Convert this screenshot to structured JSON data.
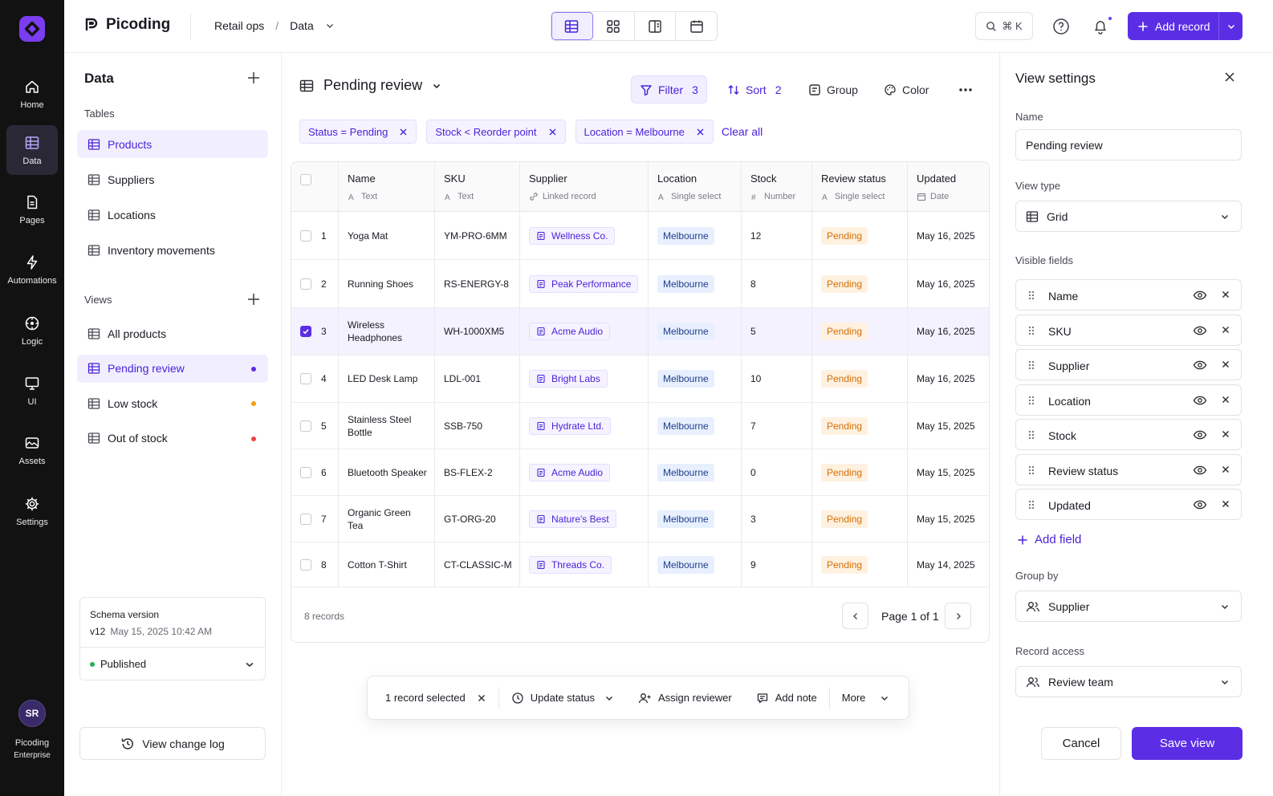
{
  "app": {
    "name": "Picoding",
    "plan_line1": "Picoding",
    "plan_line2": "Enterprise",
    "avatar": "SR",
    "accent": "#5b2ee6"
  },
  "rail": [
    {
      "label": "Home",
      "icon": "home-icon"
    },
    {
      "label": "Data",
      "icon": "table-icon",
      "active": true
    },
    {
      "label": "Pages",
      "icon": "page-icon"
    },
    {
      "label": "Automations",
      "icon": "bolt-icon"
    },
    {
      "label": "Logic",
      "icon": "logic-icon"
    },
    {
      "label": "UI",
      "icon": "monitor-icon"
    },
    {
      "label": "Assets",
      "icon": "image-icon"
    },
    {
      "label": "Settings",
      "icon": "gear-icon"
    }
  ],
  "topbar": {
    "breadcrumb": [
      "Retail ops",
      "/",
      "Data"
    ],
    "view_modes": [
      "grid-view-icon",
      "gallery-view-icon",
      "split-view-icon",
      "calendar-view-icon"
    ],
    "cmdk": "⌘ K",
    "add_record": "Add record"
  },
  "left": {
    "title": "Data",
    "tables_label": "Tables",
    "tables": [
      "Products",
      "Suppliers",
      "Locations",
      "Inventory movements"
    ],
    "views_label": "Views",
    "views": [
      {
        "label": "All products"
      },
      {
        "label": "Pending review",
        "dot": "#5b2ee6"
      },
      {
        "label": "Low stock",
        "dot": "#f59e0b"
      },
      {
        "label": "Out of stock",
        "dot": "#ef4444"
      }
    ],
    "schema": {
      "title": "Schema version",
      "version": "v12",
      "date": "May 15, 2025  10:42 AM",
      "status": "Published"
    },
    "change_log": "View change log"
  },
  "main": {
    "view_title": "Pending review",
    "filter": {
      "label": "Filter",
      "count": "3"
    },
    "sort": {
      "label": "Sort",
      "count": "2"
    },
    "group": "Group",
    "color": "Color",
    "chips": [
      "Status = Pending",
      "Stock < Reorder point",
      "Location = Melbourne"
    ],
    "clear_all": "Clear all",
    "columns": [
      {
        "name": "Name",
        "type": "Text"
      },
      {
        "name": "SKU",
        "type": "Text"
      },
      {
        "name": "Supplier",
        "type": "Linked record"
      },
      {
        "name": "Location",
        "type": "Single select"
      },
      {
        "name": "Stock",
        "type": "Number"
      },
      {
        "name": "Review status",
        "type": "Single select"
      },
      {
        "name": "Updated",
        "type": "Date"
      }
    ],
    "rows": [
      {
        "n": "1",
        "name": "Yoga Mat",
        "sku": "YM-PRO-6MM",
        "supplier": "Wellness Co.",
        "location": "Melbourne",
        "stock": "12",
        "status": "Pending",
        "updated": "May 16, 2025"
      },
      {
        "n": "2",
        "name": "Running Shoes",
        "sku": "RS-ENERGY-8",
        "supplier": "Peak Performance",
        "location": "Melbourne",
        "stock": "8",
        "status": "Pending",
        "updated": "May 16, 2025"
      },
      {
        "n": "3",
        "name": "Wireless Headphones",
        "sku": "WH-1000XM5",
        "supplier": "Acme Audio",
        "location": "Melbourne",
        "stock": "5",
        "status": "Pending",
        "updated": "May 16, 2025",
        "selected": true
      },
      {
        "n": "4",
        "name": "LED Desk Lamp",
        "sku": "LDL-001",
        "supplier": "Bright Labs",
        "location": "Melbourne",
        "stock": "10",
        "status": "Pending",
        "updated": "May 16, 2025"
      },
      {
        "n": "5",
        "name": "Stainless Steel Bottle",
        "sku": "SSB-750",
        "supplier": "Hydrate Ltd.",
        "location": "Melbourne",
        "stock": "7",
        "status": "Pending",
        "updated": "May 15, 2025"
      },
      {
        "n": "6",
        "name": "Bluetooth Speaker",
        "sku": "BS-FLEX-2",
        "supplier": "Acme Audio",
        "location": "Melbourne",
        "stock": "0",
        "status": "Pending",
        "updated": "May 15, 2025"
      },
      {
        "n": "7",
        "name": "Organic Green Tea",
        "sku": "GT-ORG-20",
        "supplier": "Nature's Best",
        "location": "Melbourne",
        "stock": "3",
        "status": "Pending",
        "updated": "May 15, 2025"
      },
      {
        "n": "8",
        "name": "Cotton T-Shirt",
        "sku": "CT-CLASSIC-M",
        "supplier": "Threads Co.",
        "location": "Melbourne",
        "stock": "9",
        "status": "Pending",
        "updated": "May 14, 2025"
      }
    ],
    "record_count": "8 records",
    "page": "Page 1 of 1",
    "action_bar": {
      "selected": "1 record selected",
      "update_status": "Update status",
      "assign": "Assign reviewer",
      "note": "Add note",
      "more": "More"
    }
  },
  "settings": {
    "title": "View settings",
    "name_label": "Name",
    "name_value": "Pending review",
    "type_label": "View type",
    "type_value": "Grid",
    "visible_label": "Visible fields",
    "fields": [
      "Name",
      "SKU",
      "Supplier",
      "Location",
      "Stock",
      "Review status",
      "Updated"
    ],
    "add_field": "Add field",
    "group_label": "Group by",
    "group_value": "Supplier",
    "access_label": "Record access",
    "access_value": "Review team",
    "cancel": "Cancel",
    "save": "Save view"
  }
}
